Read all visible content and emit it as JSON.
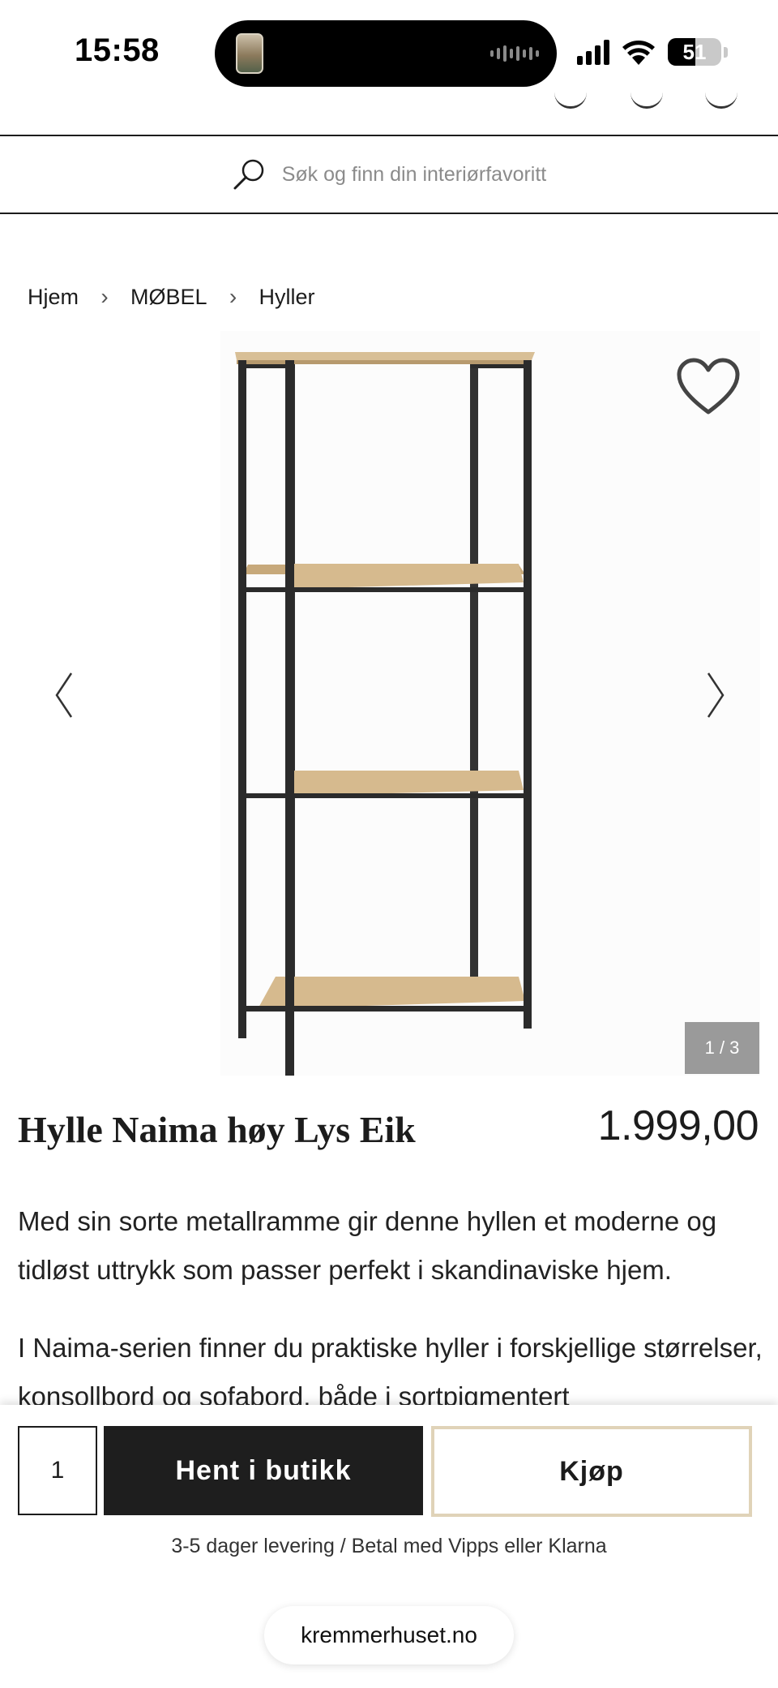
{
  "status_bar": {
    "time": "15:58",
    "battery": "51",
    "battery_level": 0.51
  },
  "search": {
    "placeholder": "Søk og finn din interiørfavoritt"
  },
  "breadcrumb": {
    "items": [
      "Hjem",
      "MØBEL",
      "Hyller"
    ],
    "separator": "›"
  },
  "gallery": {
    "counter": "1 / 3",
    "current": 1,
    "total": 3
  },
  "product": {
    "title": "Hylle Naima høy Lys Eik",
    "price": "1.999,00",
    "description_1": "Med sin sorte metallramme gir denne hyllen et moderne og tidløst uttrykk som passer perfekt i skandinaviske hjem.",
    "description_2": "I Naima-serien finner du praktiske hyller i forskjellige størrelser, konsollbord og sofabord, både i sortpigmentert"
  },
  "buy_panel": {
    "quantity": "1",
    "pickup_label": "Hent i butikk",
    "buy_label": "Kjøp",
    "delivery_note": "3-5 dager levering / Betal med Vipps eller Klarna"
  },
  "browser": {
    "url": "kremmerhuset.no"
  },
  "colors": {
    "primary_button": "#1e1e1e",
    "buy_border": "#e0d3b8",
    "oak": "#d2b68c",
    "frame": "#2b2b2b"
  }
}
